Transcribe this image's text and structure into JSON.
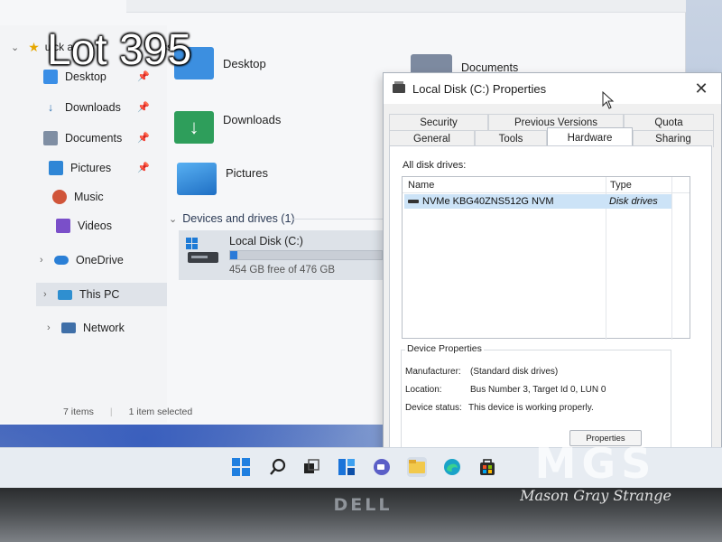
{
  "overlay": {
    "lot_label": "Lot 395",
    "watermark_letters": "MGS",
    "watermark_tagline": "Mason Gray Strange"
  },
  "explorer": {
    "quick_access_fragment": "uick a",
    "quick_access_tail": "ss",
    "nav_items": [
      {
        "label": "Desktop",
        "icon": "desktop-icon",
        "pinned": true
      },
      {
        "label": "Downloads",
        "icon": "download-icon",
        "pinned": true
      },
      {
        "label": "Documents",
        "icon": "document-icon",
        "pinned": true
      },
      {
        "label": "Pictures",
        "icon": "pictures-icon",
        "pinned": true
      },
      {
        "label": "Music",
        "icon": "music-icon",
        "pinned": false
      },
      {
        "label": "Videos",
        "icon": "videos-icon",
        "pinned": false
      },
      {
        "label": "OneDrive",
        "icon": "onedrive-icon",
        "pinned": false
      },
      {
        "label": "This PC",
        "icon": "this-pc-icon",
        "pinned": false
      },
      {
        "label": "Network",
        "icon": "network-icon",
        "pinned": false
      }
    ],
    "folders": [
      {
        "label": "Desktop",
        "icon": "desktop-folder-icon"
      },
      {
        "label": "Downloads",
        "icon": "downloads-folder-icon"
      },
      {
        "label": "Pictures",
        "icon": "pictures-folder-icon"
      },
      {
        "label": "Documents",
        "icon": "documents-folder-icon"
      }
    ],
    "devices_section": "Devices and drives (1)",
    "drive": {
      "name": "Local Disk (C:)",
      "free_text": "454 GB free of 476 GB",
      "used_fraction": 0.046
    },
    "status": {
      "items": "7 items",
      "selected": "1 item selected"
    }
  },
  "dialog": {
    "title": "Local Disk (C:) Properties",
    "close": "✕",
    "tabs_row1": [
      "Security",
      "Previous Versions",
      "Quota"
    ],
    "tabs_row2": [
      "General",
      "Tools",
      "Hardware",
      "Sharing"
    ],
    "active_tab": "Hardware",
    "all_disk_drives_label": "All disk drives:",
    "columns": [
      "Name",
      "Type"
    ],
    "rows": [
      {
        "name": "NVMe KBG40ZNS512G NVM",
        "type": "Disk drives"
      }
    ],
    "device_properties": {
      "group_title": "Device Properties",
      "manufacturer_label": "Manufacturer:",
      "manufacturer_value": "(Standard disk drives)",
      "location_label": "Location:",
      "location_value": "Bus Number 3, Target Id 0, LUN 0",
      "status_label": "Device status:",
      "status_value": "This device is working properly."
    },
    "properties_button": "Properties"
  },
  "taskbar": {
    "icons": [
      "start-icon",
      "search-icon",
      "task-view-icon",
      "widgets-icon",
      "chat-icon",
      "file-explorer-icon",
      "edge-icon",
      "store-icon"
    ]
  },
  "bezel": {
    "brand": "DELL"
  },
  "colors": {
    "accent": "#2b7ad8",
    "selection": "#cce3f7",
    "folder_yellow": "#f2c94c",
    "download_green": "#2e9e5b"
  }
}
